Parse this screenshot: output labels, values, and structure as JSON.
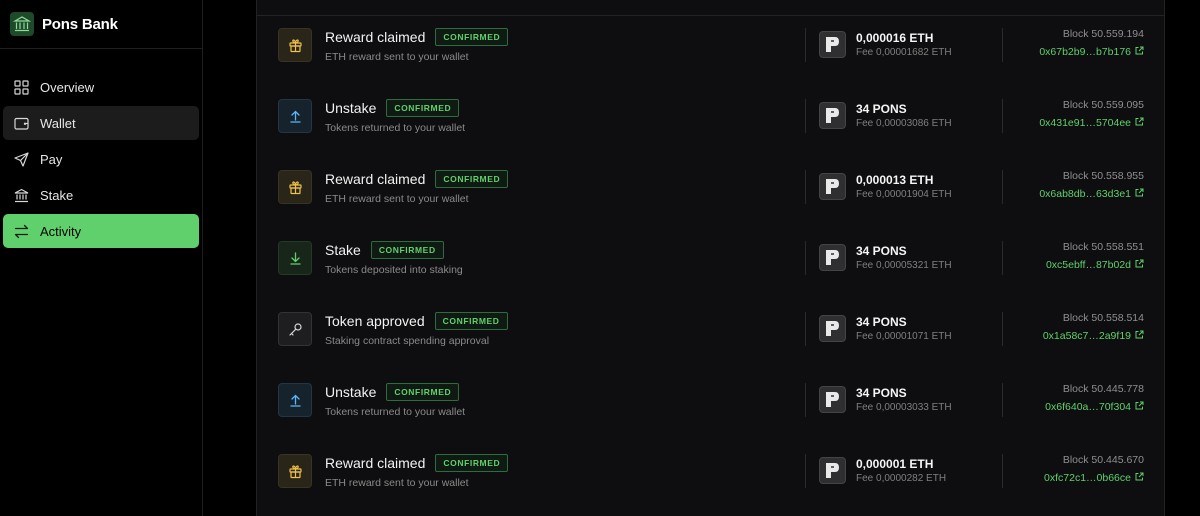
{
  "brand": {
    "name": "Pons Bank",
    "icon": "bank-building-icon"
  },
  "nav": {
    "items": [
      {
        "label": "Overview",
        "icon": "grid-icon"
      },
      {
        "label": "Wallet",
        "icon": "wallet-icon"
      },
      {
        "label": "Pay",
        "icon": "send-icon"
      },
      {
        "label": "Stake",
        "icon": "bank-icon"
      },
      {
        "label": "Activity",
        "icon": "arrows-swap-icon"
      }
    ],
    "hovered": "Wallet",
    "active": "Activity"
  },
  "colors": {
    "accent": "#5fd06c",
    "background": "#000000",
    "panel": "#0e0e10"
  },
  "activity": {
    "rows": [
      {
        "type": "gift",
        "title": "Reward claimed",
        "status": "CONFIRMED",
        "subtitle": "ETH reward sent to your wallet",
        "amount": "0,000016 ETH",
        "fee": "Fee 0,00001682 ETH",
        "block": "Block 50.559.194",
        "hash": "0x67b2b9…b7b176"
      },
      {
        "type": "up",
        "title": "Unstake",
        "status": "CONFIRMED",
        "subtitle": "Tokens returned to your wallet",
        "amount": "34 PONS",
        "fee": "Fee 0,00003086 ETH",
        "block": "Block 50.559.095",
        "hash": "0x431e91…5704ee"
      },
      {
        "type": "gift",
        "title": "Reward claimed",
        "status": "CONFIRMED",
        "subtitle": "ETH reward sent to your wallet",
        "amount": "0,000013 ETH",
        "fee": "Fee 0,00001904 ETH",
        "block": "Block 50.558.955",
        "hash": "0x6ab8db…63d3e1"
      },
      {
        "type": "down",
        "title": "Stake",
        "status": "CONFIRMED",
        "subtitle": "Tokens deposited into staking",
        "amount": "34 PONS",
        "fee": "Fee 0,00005321 ETH",
        "block": "Block 50.558.551",
        "hash": "0xc5ebff…87b02d"
      },
      {
        "type": "key",
        "title": "Token approved",
        "status": "CONFIRMED",
        "subtitle": "Staking contract spending approval",
        "amount": "34 PONS",
        "fee": "Fee 0,00001071 ETH",
        "block": "Block 50.558.514",
        "hash": "0x1a58c7…2a9f19"
      },
      {
        "type": "up",
        "title": "Unstake",
        "status": "CONFIRMED",
        "subtitle": "Tokens returned to your wallet",
        "amount": "34 PONS",
        "fee": "Fee 0,00003033 ETH",
        "block": "Block 50.445.778",
        "hash": "0x6f640a…70f304"
      },
      {
        "type": "gift",
        "title": "Reward claimed",
        "status": "CONFIRMED",
        "subtitle": "ETH reward sent to your wallet",
        "amount": "0,000001 ETH",
        "fee": "Fee 0,0000282 ETH",
        "block": "Block 50.445.670",
        "hash": "0xfc72c1…0b66ce"
      }
    ]
  }
}
